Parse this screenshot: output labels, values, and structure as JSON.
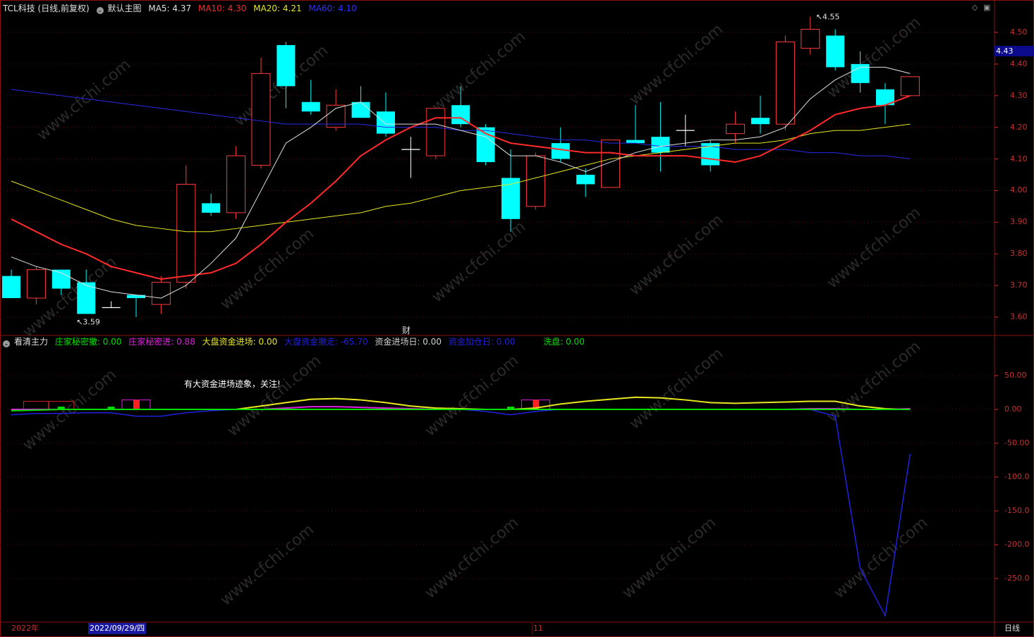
{
  "header": {
    "stock": "TCL科技 (日线,前复权)",
    "template": "默认主图",
    "ma5": "MA5: 4.37",
    "ma10": "MA10: 4.30",
    "ma20": "MA20: 4.21",
    "ma60": "MA60: 4.10",
    "ma_colors": {
      "ma5": "#e0e0e0",
      "ma10": "#ff2a2a",
      "ma20": "#e8e820",
      "ma60": "#2020e0"
    }
  },
  "indicator_header": {
    "name": "看清主力",
    "items": [
      {
        "label": "庄家秘密撤: 0.00",
        "color": "#00e000"
      },
      {
        "label": "庄家秘密进: 0.88",
        "color": "#e020e0"
      },
      {
        "label": "大盘资金进场: 0.00",
        "color": "#e8e820"
      },
      {
        "label": "大盘资金撤走: -65.70",
        "color": "#2020e0"
      },
      {
        "label": "资金进场日: 0.00",
        "color": "#d0d0d0"
      },
      {
        "label": "资金加仓日: 0.00",
        "color": "#2020e0"
      },
      {
        "label": "洗盘: 0.00",
        "color": "#00e000"
      }
    ]
  },
  "price_axis": {
    "ticks": [
      "4.50",
      "4.40",
      "4.30",
      "4.20",
      "4.10",
      "4.00",
      "3.90",
      "3.80",
      "3.70",
      "3.60"
    ],
    "current": "4.43"
  },
  "indicator_axis": {
    "ticks": [
      "50.00",
      "0.00",
      "-50.00",
      "-100.0",
      "-150.0",
      "-200.0",
      "-250.0"
    ]
  },
  "x_axis": {
    "year": "2022年",
    "cursor_date": "2022/09/29/四",
    "month": "11",
    "period": "日线"
  },
  "annotation": "有大资金进场迹象，关注!",
  "finance_mark": "财",
  "watermark": "www.cfchi.com",
  "chart_data": [
    {
      "type": "candlestick",
      "title": "TCL科技 (日线,前复权)",
      "ylim": [
        3.56,
        4.58
      ],
      "high_label": "4.55",
      "low_label": "3.59",
      "up_color": "#ff3a3a",
      "down_color": "#00ffff",
      "candles": [
        {
          "o": 3.73,
          "h": 3.75,
          "l": 3.66,
          "c": 3.66
        },
        {
          "o": 3.66,
          "h": 3.76,
          "l": 3.64,
          "c": 3.75
        },
        {
          "o": 3.75,
          "h": 3.75,
          "l": 3.67,
          "c": 3.69
        },
        {
          "o": 3.71,
          "h": 3.75,
          "l": 3.61,
          "c": 3.61
        },
        {
          "o": 3.63,
          "h": 3.65,
          "l": 3.63,
          "c": 3.63
        },
        {
          "o": 3.67,
          "h": 3.67,
          "l": 3.6,
          "c": 3.66
        },
        {
          "o": 3.64,
          "h": 3.73,
          "l": 3.61,
          "c": 3.71
        },
        {
          "o": 3.71,
          "h": 4.08,
          "l": 3.69,
          "c": 4.02
        },
        {
          "o": 3.96,
          "h": 3.99,
          "l": 3.92,
          "c": 3.93
        },
        {
          "o": 3.93,
          "h": 4.14,
          "l": 3.91,
          "c": 4.11
        },
        {
          "o": 4.08,
          "h": 4.42,
          "l": 4.07,
          "c": 4.37
        },
        {
          "o": 4.46,
          "h": 4.47,
          "l": 4.26,
          "c": 4.33
        },
        {
          "o": 4.28,
          "h": 4.35,
          "l": 4.24,
          "c": 4.25
        },
        {
          "o": 4.2,
          "h": 4.32,
          "l": 4.19,
          "c": 4.27
        },
        {
          "o": 4.28,
          "h": 4.33,
          "l": 4.23,
          "c": 4.23
        },
        {
          "o": 4.25,
          "h": 4.31,
          "l": 4.17,
          "c": 4.18
        },
        {
          "o": 4.13,
          "h": 4.17,
          "l": 4.04,
          "c": 4.13
        },
        {
          "o": 4.11,
          "h": 4.26,
          "l": 4.1,
          "c": 4.26
        },
        {
          "o": 4.27,
          "h": 4.33,
          "l": 4.2,
          "c": 4.21
        },
        {
          "o": 4.2,
          "h": 4.21,
          "l": 4.08,
          "c": 4.09
        },
        {
          "o": 4.04,
          "h": 4.13,
          "l": 3.87,
          "c": 3.91
        },
        {
          "o": 3.95,
          "h": 4.12,
          "l": 3.94,
          "c": 4.11
        },
        {
          "o": 4.15,
          "h": 4.2,
          "l": 4.09,
          "c": 4.1
        },
        {
          "o": 4.05,
          "h": 4.07,
          "l": 3.98,
          "c": 4.02
        },
        {
          "o": 4.01,
          "h": 4.16,
          "l": 4.01,
          "c": 4.16
        },
        {
          "o": 4.16,
          "h": 4.27,
          "l": 4.15,
          "c": 4.15
        },
        {
          "o": 4.17,
          "h": 4.28,
          "l": 4.06,
          "c": 4.12
        },
        {
          "o": 4.19,
          "h": 4.24,
          "l": 4.14,
          "c": 4.19
        },
        {
          "o": 4.15,
          "h": 4.16,
          "l": 4.06,
          "c": 4.08
        },
        {
          "o": 4.18,
          "h": 4.25,
          "l": 4.15,
          "c": 4.21
        },
        {
          "o": 4.23,
          "h": 4.3,
          "l": 4.18,
          "c": 4.21
        },
        {
          "o": 4.21,
          "h": 4.49,
          "l": 4.19,
          "c": 4.47
        },
        {
          "o": 4.45,
          "h": 4.55,
          "l": 4.43,
          "c": 4.51
        },
        {
          "o": 4.49,
          "h": 4.51,
          "l": 4.38,
          "c": 4.39
        },
        {
          "o": 4.4,
          "h": 4.44,
          "l": 4.31,
          "c": 4.34
        },
        {
          "o": 4.32,
          "h": 4.34,
          "l": 4.21,
          "c": 4.27
        },
        {
          "o": 4.3,
          "h": 4.36,
          "l": 4.3,
          "c": 4.36
        }
      ],
      "ma5": [
        3.79,
        3.76,
        3.74,
        3.7,
        3.68,
        3.67,
        3.66,
        3.7,
        3.77,
        3.85,
        4.0,
        4.15,
        4.2,
        4.26,
        4.28,
        4.21,
        4.21,
        4.21,
        4.19,
        4.17,
        4.11,
        4.11,
        4.09,
        4.06,
        4.09,
        4.12,
        4.14,
        4.15,
        4.16,
        4.16,
        4.17,
        4.2,
        4.29,
        4.35,
        4.39,
        4.39,
        4.37
      ],
      "ma10": [
        3.91,
        3.87,
        3.83,
        3.8,
        3.76,
        3.74,
        3.72,
        3.73,
        3.74,
        3.77,
        3.83,
        3.9,
        3.96,
        4.03,
        4.11,
        4.16,
        4.2,
        4.23,
        4.23,
        4.18,
        4.15,
        4.14,
        4.13,
        4.12,
        4.12,
        4.11,
        4.11,
        4.11,
        4.1,
        4.09,
        4.11,
        4.15,
        4.19,
        4.24,
        4.26,
        4.27,
        4.3
      ],
      "ma20": [
        4.03,
        4.0,
        3.97,
        3.94,
        3.91,
        3.89,
        3.88,
        3.87,
        3.87,
        3.88,
        3.89,
        3.9,
        3.91,
        3.92,
        3.93,
        3.95,
        3.96,
        3.98,
        4.0,
        4.01,
        4.02,
        4.04,
        4.06,
        4.08,
        4.1,
        4.11,
        4.12,
        4.13,
        4.14,
        4.15,
        4.15,
        4.16,
        4.18,
        4.19,
        4.19,
        4.2,
        4.21
      ],
      "ma60": [
        4.32,
        4.31,
        4.3,
        4.29,
        4.28,
        4.27,
        4.26,
        4.25,
        4.24,
        4.23,
        4.22,
        4.21,
        4.21,
        4.21,
        4.21,
        4.2,
        4.2,
        4.2,
        4.19,
        4.19,
        4.18,
        4.17,
        4.16,
        4.16,
        4.15,
        4.15,
        4.14,
        4.14,
        4.14,
        4.13,
        4.13,
        4.13,
        4.12,
        4.12,
        4.11,
        4.11,
        4.1
      ]
    },
    {
      "type": "line",
      "title": "看清主力",
      "ylim": [
        -320,
        100
      ],
      "series": [
        {
          "name": "庄家秘密撤",
          "color": "#00e000",
          "values": [
            -2,
            -1,
            0,
            0,
            0,
            0,
            0,
            0,
            0,
            0,
            0,
            0,
            0,
            0,
            0,
            0,
            0,
            0,
            0,
            0,
            0,
            0,
            0,
            0,
            0,
            0,
            0,
            0,
            0,
            0,
            0,
            0,
            0,
            0,
            0,
            0,
            0
          ]
        },
        {
          "name": "庄家秘密进",
          "color": "#e020e0",
          "values": [
            0,
            0,
            0,
            0,
            0,
            0,
            0,
            0,
            0,
            0,
            0,
            2,
            4,
            4,
            3,
            2,
            1,
            0,
            0,
            0,
            0,
            0,
            0,
            0,
            0,
            0,
            0,
            0,
            0,
            0,
            0,
            0,
            1,
            1,
            0,
            0,
            1
          ]
        },
        {
          "name": "大盘资金进场",
          "color": "#e8e820",
          "values": [
            0,
            0,
            0,
            0,
            0,
            0,
            0,
            0,
            0,
            0,
            5,
            10,
            15,
            16,
            14,
            10,
            5,
            2,
            1,
            0,
            0,
            2,
            8,
            12,
            15,
            18,
            17,
            14,
            10,
            9,
            10,
            11,
            12,
            12,
            5,
            1,
            0
          ]
        },
        {
          "name": "大盘资金撤走",
          "color": "#2020e0",
          "values": [
            -8,
            -6,
            -6,
            -5,
            -5,
            -10,
            -10,
            -5,
            -2,
            0,
            0,
            0,
            0,
            0,
            0,
            0,
            0,
            0,
            0,
            -3,
            -8,
            -3,
            0,
            0,
            0,
            0,
            0,
            0,
            0,
            0,
            0,
            0,
            0,
            -10,
            -235,
            -305,
            -65.7
          ]
        }
      ],
      "bars_red": [
        5,
        21
      ],
      "bars_green": [
        2,
        4,
        20
      ]
    }
  ]
}
